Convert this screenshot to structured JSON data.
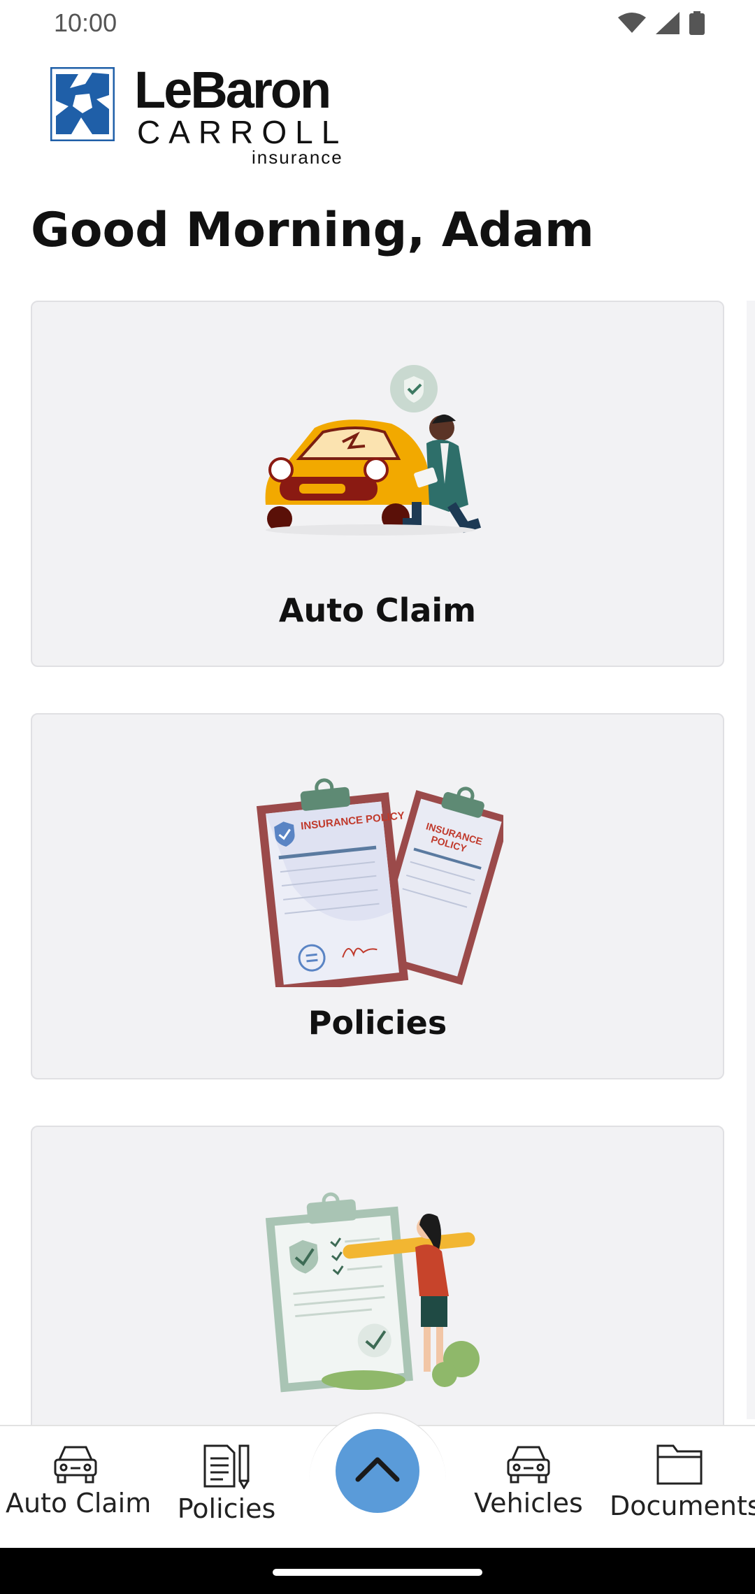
{
  "status_bar": {
    "time": "10:00"
  },
  "header": {
    "logo_line1": "LeBaron",
    "logo_line2": "CARROLL",
    "logo_line3": "insurance"
  },
  "greeting": "Good Morning, Adam",
  "cards": [
    {
      "label": "Auto Claim",
      "illustration": "car-claim-illustration"
    },
    {
      "label": "Policies",
      "illustration": "insurance-policy-illustration",
      "illustration_text": "INSURANCE POLICY"
    },
    {
      "label": "",
      "illustration": "checklist-illustration"
    }
  ],
  "bottom_nav": {
    "items": [
      {
        "label": "Auto Claim",
        "icon": "car-icon"
      },
      {
        "label": "Policies",
        "icon": "document-pen-icon"
      },
      {
        "label": "",
        "icon": "chevron-up-icon"
      },
      {
        "label": "Vehicles",
        "icon": "car-icon"
      },
      {
        "label": "Documents",
        "icon": "folder-icon"
      }
    ]
  },
  "colors": {
    "accent": "#5a9bd9",
    "card_bg": "#f2f2f4",
    "logo_blue": "#1f5fa8"
  }
}
